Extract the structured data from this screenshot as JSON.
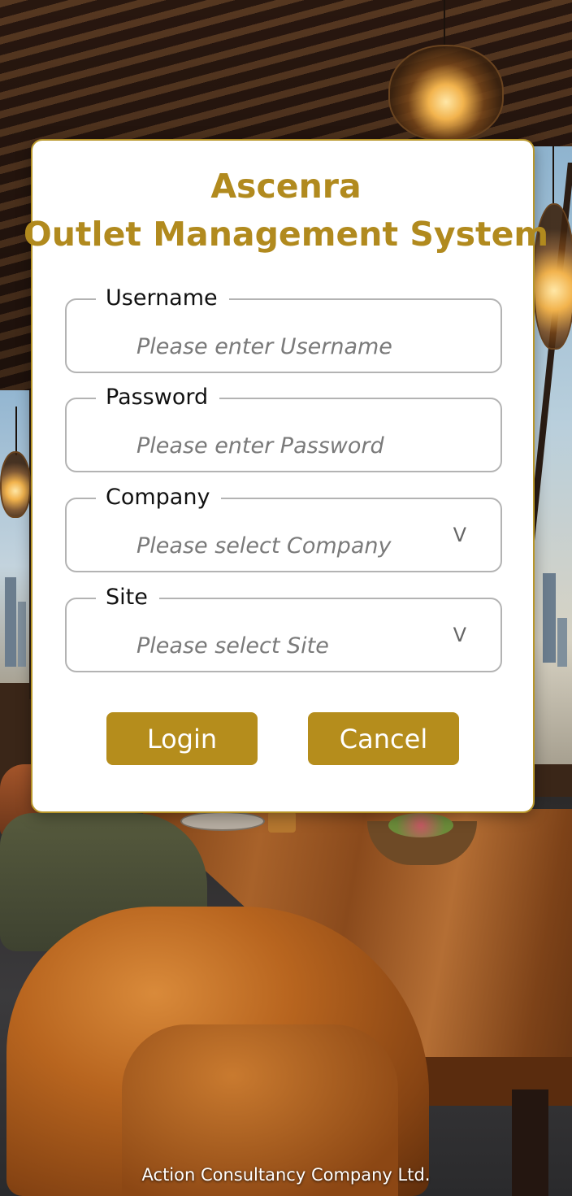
{
  "app": {
    "title_line1": "Ascenra",
    "title_line2": "Outlet Management System"
  },
  "form": {
    "username": {
      "label": "Username",
      "placeholder": "Please enter Username",
      "value": ""
    },
    "password": {
      "label": "Password",
      "placeholder": "Please enter Password",
      "value": ""
    },
    "company": {
      "label": "Company",
      "placeholder": "Please select Company",
      "chevron": "V"
    },
    "site": {
      "label": "Site",
      "placeholder": "Please select Site",
      "chevron": "V"
    }
  },
  "buttons": {
    "login_label": "Login",
    "cancel_label": "Cancel"
  },
  "footer": {
    "text": "Action Consultancy Company Ltd."
  },
  "colors": {
    "accent": "#b58d1c",
    "title": "#b18a1e",
    "card_border": "#b8962a",
    "field_border": "#b3b3b3"
  }
}
